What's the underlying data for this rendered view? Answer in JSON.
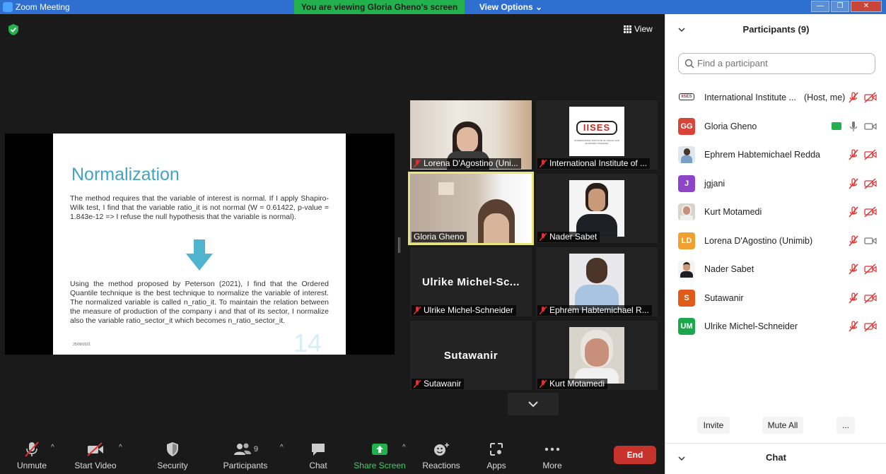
{
  "window": {
    "title": "Zoom Meeting",
    "viewing_banner": "You are viewing Gloria Gheno's screen",
    "view_options": "View Options"
  },
  "stage": {
    "view_label": "View"
  },
  "slide": {
    "title": "Normalization",
    "paragraph1": "The method requires that the variable of interest is normal. If I apply Shapiro-Wilk test, I find that the variable ratio_it is not normal (W = 0.61422, p-value = 1.843e-12 => I refuse the null hypothesis that the variable is normal).",
    "paragraph2": "Using the method proposed by Peterson (2021), I find that the Ordered Quantile technique is the best technique to normalize the variable of interest. The normalized variable is called n_ratio_it. To maintain the relation between the measure of production of the company i and that of its sector, I normalize also the variable ratio_sector_it which becomes n_ratio_sector_it.",
    "date": "25/09/2021",
    "page_number": "14"
  },
  "gallery": {
    "tiles": [
      {
        "name": "Lorena D'Agostino (Uni...",
        "big": ""
      },
      {
        "name": "International Institute of ...",
        "big": ""
      },
      {
        "name": "Gloria Gheno",
        "big": ""
      },
      {
        "name": "Nader Sabet",
        "big": ""
      },
      {
        "name": "Ulrike Michel-Schneider",
        "big": "Ulrike  Michel-Sc..."
      },
      {
        "name": "Ephrem Habtemichael R...",
        "big": ""
      },
      {
        "name": "Sutawanir",
        "big": "Sutawanir"
      },
      {
        "name": "Kurt Motamedi",
        "big": ""
      }
    ],
    "logo_text": "IISES",
    "logo_subtext": "INTERNATIONAL INSTITUTE OF SOCIAL AND ECONOMIC SCIENCES"
  },
  "toolbar": {
    "unmute": "Unmute",
    "start_video": "Start Video",
    "security": "Security",
    "participants": "Participants",
    "participants_count": "9",
    "chat": "Chat",
    "share_screen": "Share Screen",
    "reactions": "Reactions",
    "apps": "Apps",
    "more": "More",
    "end": "End"
  },
  "panel": {
    "header": "Participants (9)",
    "search_placeholder": "Find a participant",
    "participants": [
      {
        "initials": "",
        "name": "International Institute ...",
        "role": "(Host, me)",
        "color": "#ffffff"
      },
      {
        "initials": "GG",
        "name": "Gloria Gheno",
        "role": "",
        "color": "#d9443a"
      },
      {
        "initials": "",
        "name": "Ephrem Habtemichael Redda",
        "role": "",
        "color": "#5a5a5a"
      },
      {
        "initials": "J",
        "name": "jgjani",
        "role": "",
        "color": "#8e44c8"
      },
      {
        "initials": "",
        "name": "Kurt Motamedi",
        "role": "",
        "color": "#8a8a8a"
      },
      {
        "initials": "LD",
        "name": "Lorena D'Agostino (Unimib)",
        "role": "",
        "color": "#f0a030"
      },
      {
        "initials": "",
        "name": "Nader Sabet",
        "role": "",
        "color": "#6a4a3a"
      },
      {
        "initials": "S",
        "name": "Sutawanir",
        "role": "",
        "color": "#e05a1a"
      },
      {
        "initials": "UM",
        "name": "Ulrike Michel-Schneider",
        "role": "",
        "color": "#1aa84a"
      }
    ],
    "invite": "Invite",
    "mute_all": "Mute All",
    "more": "...",
    "chat_header": "Chat"
  }
}
